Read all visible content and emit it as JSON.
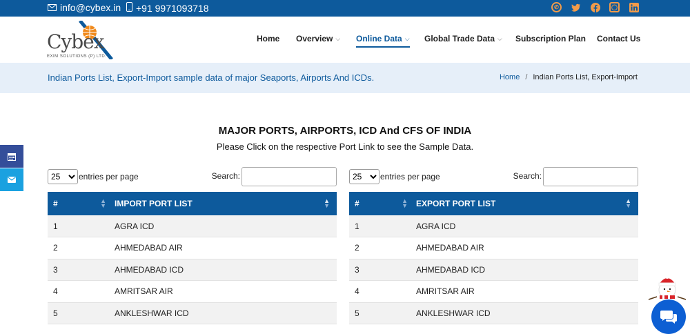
{
  "topbar": {
    "email": "info@cybex.in",
    "phone": "+91 9971093718",
    "socials": [
      "whatsapp-icon",
      "twitter-icon",
      "facebook-icon",
      "instagram-icon",
      "linkedin-icon"
    ]
  },
  "logo": {
    "word": "Cybex",
    "tagline": "EXIM SOLUTIONS (P) LTD."
  },
  "nav": {
    "home": "Home",
    "overview": "Overview",
    "online_data": "Online Data",
    "global_trade": "Global Trade Data",
    "subscription": "Subscription Plan",
    "contact": "Contact Us"
  },
  "band": {
    "title": "Indian Ports List, Export-Import sample data of major Seaports, Airports And ICDs.",
    "crumb_home": "Home",
    "crumb_sep": "/",
    "crumb_current": "Indian Ports List, Export-Import"
  },
  "main": {
    "title": "MAJOR PORTS, AIRPORTS, ICD And CFS OF INDIA",
    "subtitle": "Please Click on the respective Port Link to see the Sample Data."
  },
  "import_table": {
    "entries_value": "25",
    "entries_label": "entries per page",
    "search_label": "Search:",
    "col_num": "#",
    "col_name": "IMPORT PORT LIST",
    "rows": [
      {
        "num": "1",
        "name": "AGRA ICD"
      },
      {
        "num": "2",
        "name": "AHMEDABAD AIR"
      },
      {
        "num": "3",
        "name": "AHMEDABAD ICD"
      },
      {
        "num": "4",
        "name": "AMRITSAR AIR"
      },
      {
        "num": "5",
        "name": "ANKLESHWAR ICD"
      }
    ]
  },
  "export_table": {
    "entries_value": "25",
    "entries_label": "entries per page",
    "search_label": "Search:",
    "col_num": "#",
    "col_name": "EXPORT PORT LIST",
    "rows": [
      {
        "num": "1",
        "name": "AGRA ICD"
      },
      {
        "num": "2",
        "name": "AHMEDABAD AIR"
      },
      {
        "num": "3",
        "name": "AHMEDABAD ICD"
      },
      {
        "num": "4",
        "name": "AMRITSAR AIR"
      },
      {
        "num": "5",
        "name": "ANKLESHWAR ICD"
      }
    ]
  },
  "colors": {
    "primary": "#0d5a9c",
    "band": "#e6eff9",
    "social": "#f19b4a",
    "chat": "#0d5fd3"
  }
}
